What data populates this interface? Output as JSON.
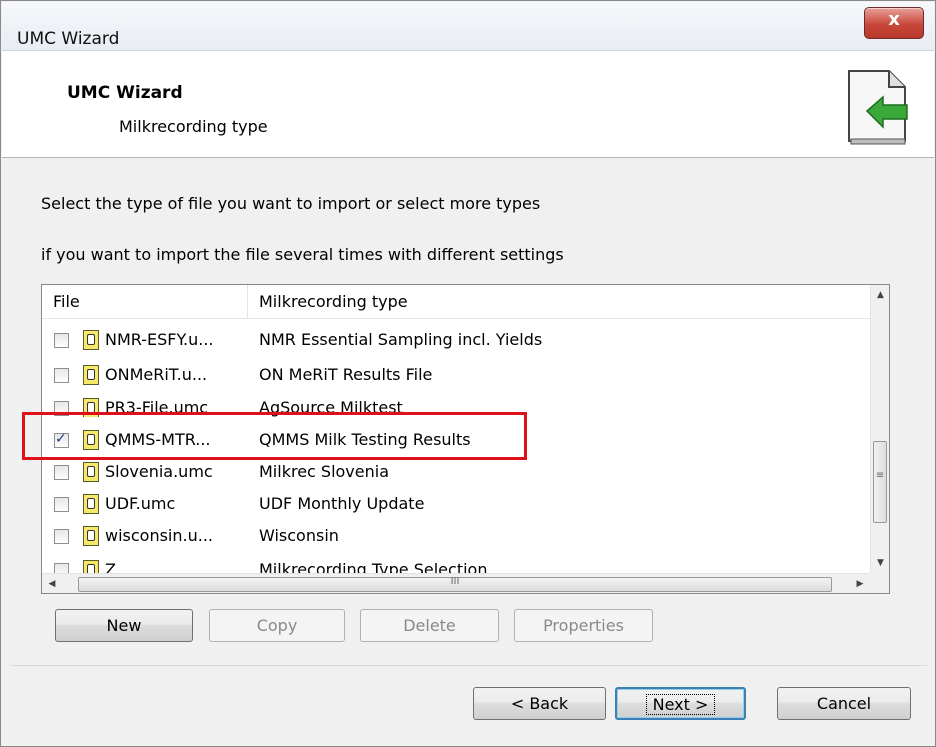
{
  "window": {
    "title": "UMC Wizard",
    "close_label": "x"
  },
  "header": {
    "title": "UMC Wizard",
    "subtitle": "Milkrecording type",
    "icon": "import-arrow-icon"
  },
  "instructions": {
    "line1": "Select the type of file you want to import or select more types",
    "line2": "if you want to import the file several times with different settings"
  },
  "list": {
    "columns": [
      "File",
      "Milkrecording type"
    ],
    "rows": [
      {
        "file": "NMR-ESFY.u...",
        "type": "NMR Essential Sampling incl. Yields",
        "checked": false
      },
      {
        "file": "ONMeRiT.u...",
        "type": "ON MeRiT Results File",
        "checked": false
      },
      {
        "file": "PR3-File.umc",
        "type": "AgSource Milktest",
        "checked": false
      },
      {
        "file": "QMMS-MTR...",
        "type": "QMMS Milk Testing Results",
        "checked": true
      },
      {
        "file": "Slovenia.umc",
        "type": "Milkrec Slovenia",
        "checked": false
      },
      {
        "file": "UDF.umc",
        "type": "UDF Monthly Update",
        "checked": false
      },
      {
        "file": "wisconsin.u...",
        "type": "Wisconsin",
        "checked": false
      },
      {
        "file": "Z...",
        "type": "Milkrecording Type Selection",
        "checked": false
      }
    ],
    "scroll": {
      "vthumb_grip": "≡",
      "hthumb_grip": "III",
      "up": "▲",
      "down": "▼",
      "left": "◀",
      "right": "▶"
    }
  },
  "list_buttons": {
    "new": "New",
    "copy": "Copy",
    "delete": "Delete",
    "properties": "Properties"
  },
  "nav_buttons": {
    "back": "< Back",
    "next": "Next >",
    "cancel": "Cancel"
  },
  "colors": {
    "highlight": "#e0101a",
    "close_button": "#c7483a",
    "arrow_green": "#3aa93a"
  }
}
